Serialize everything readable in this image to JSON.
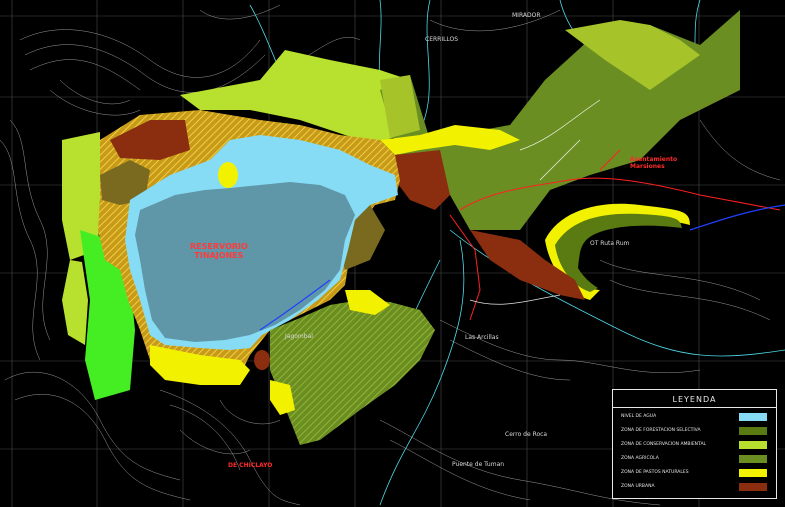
{
  "labels": {
    "reservoir_line1": "RESERVORIO",
    "reservoir_line2": "TINAJONES",
    "mirador": "MIRADOR",
    "cerrillos": "CERRILLOS",
    "asentamiento": "Asentamiento",
    "asentamiento_line2": "Marsiones",
    "las_arcillas": "Las Arcillas",
    "cerro_de_roca": "Cerro de Roca",
    "puente_de_tuman": "Puente de Tuman",
    "de_chiclayo": "DE CHICLAYO",
    "jaguar": "Jagombal",
    "ruta_road": "OT Ruta Rum"
  },
  "legend": {
    "title": "LEYENDA",
    "items": [
      {
        "label": "NIVEL DE AGUA",
        "color": "#87dcf5"
      },
      {
        "label": "ZONA DE FORESTACION SELECTIVA",
        "color": "#5a7a12"
      },
      {
        "label": "ZONA DE CONSERVACION AMBIENTAL",
        "color": "#b8e02e"
      },
      {
        "label": "ZONA AGRICOLA",
        "color": "#6b8e23"
      },
      {
        "label": "ZONA DE PASTOS NATURALES",
        "color": "#f2f200"
      },
      {
        "label": "ZONA URBANA",
        "color": "#8b2e10"
      }
    ]
  },
  "colors": {
    "water": "#87dcf5",
    "reservoir": "#5f97a8",
    "forestation": "#5a7a12",
    "conservation": "#b8e02e",
    "agricultural": "#6b8e23",
    "pasture": "#f2f200",
    "urban": "#8b2e10",
    "bright_green": "#44ee22"
  }
}
